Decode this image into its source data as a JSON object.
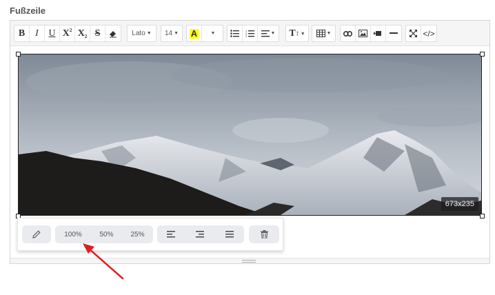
{
  "section": {
    "label": "Fußzeile"
  },
  "toolbar": {
    "font_name": "Lato",
    "font_size": "14",
    "highlight_letter": "A",
    "highlight_color": "#ffff00",
    "icons": [
      "bold-icon",
      "italic-icon",
      "underline-icon",
      "superscript-icon",
      "subscript-icon",
      "strikethrough-icon",
      "eraser-icon",
      "unordered-list-icon",
      "ordered-list-icon",
      "align-icon",
      "line-height-icon",
      "table-icon",
      "link-icon",
      "picture-icon",
      "video-icon",
      "horizontal-rule-icon",
      "fullscreen-icon",
      "code-view-icon"
    ]
  },
  "image": {
    "dimensions": "673x235",
    "description_icons": [
      "mountain-photo"
    ]
  },
  "image_popover": {
    "edit_icon": "pencil-icon",
    "size_full": "100%",
    "size_half": "50%",
    "size_quarter": "25%",
    "icons": [
      "pencil-icon",
      "align-left-icon",
      "align-right-icon",
      "justify-icon",
      "trash-icon"
    ]
  },
  "annotation": {
    "arrow_color": "#e02020"
  }
}
